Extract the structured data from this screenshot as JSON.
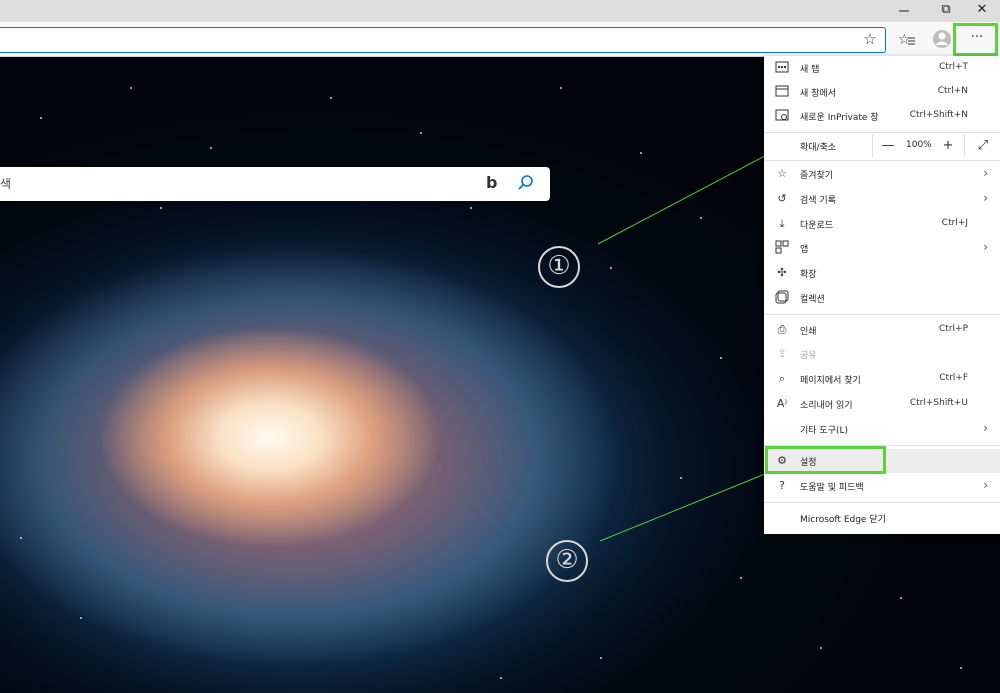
{
  "window": {
    "restore_glyph": "⧉",
    "close_glyph": "✕"
  },
  "toolbar": {
    "favorite_star_glyph": "☆",
    "favorites_glyph": "✩≡",
    "more_label": "···"
  },
  "search": {
    "partial_text": "색"
  },
  "callouts": [
    "①",
    "②"
  ],
  "menu": {
    "items": [
      {
        "icon": "new-tab-icon",
        "label": "새 탭",
        "shortcut": "Ctrl+T"
      },
      {
        "icon": "new-window-icon",
        "label": "새 창에서",
        "shortcut": "Ctrl+N"
      },
      {
        "icon": "inprivate-icon",
        "label": "새로운 InPrivate 창",
        "shortcut": "Ctrl+Shift+N"
      }
    ],
    "zoom": {
      "label": "확대/축소",
      "minus": "—",
      "value": "100%",
      "plus": "+",
      "fullscreen": "⤢"
    },
    "items2": [
      {
        "icon": "favorites-icon",
        "label": "즐겨찾기",
        "shortcut": "",
        "arrow": true
      },
      {
        "icon": "history-icon",
        "label": "검색 기록",
        "shortcut": "",
        "arrow": true
      },
      {
        "icon": "download-icon",
        "label": "다운로드",
        "shortcut": "Ctrl+J",
        "arrow": false
      },
      {
        "icon": "apps-icon",
        "label": "앱",
        "shortcut": "",
        "arrow": true
      },
      {
        "icon": "extensions-icon",
        "label": "확장",
        "shortcut": "",
        "arrow": false
      },
      {
        "icon": "collections-icon",
        "label": "컬렉션",
        "shortcut": "",
        "arrow": false
      }
    ],
    "items3": [
      {
        "icon": "print-icon",
        "label": "인쇄",
        "shortcut": "Ctrl+P",
        "arrow": false,
        "disabled": false
      },
      {
        "icon": "share-icon",
        "label": "공유",
        "shortcut": "",
        "arrow": false,
        "disabled": true
      },
      {
        "icon": "find-icon",
        "label": "페이지에서 찾기",
        "shortcut": "Ctrl+F",
        "arrow": false,
        "disabled": false
      },
      {
        "icon": "read-aloud-icon",
        "label": "소리내어 읽기",
        "shortcut": "Ctrl+Shift+U",
        "arrow": false,
        "disabled": false
      },
      {
        "icon": "",
        "label": "기타 도구(L)",
        "shortcut": "",
        "arrow": true,
        "disabled": false
      }
    ],
    "items4": [
      {
        "icon": "gear-icon",
        "label": "설정",
        "shortcut": "",
        "arrow": false
      },
      {
        "icon": "help-icon",
        "label": "도움말 및 피드백",
        "shortcut": "",
        "arrow": true
      }
    ],
    "close_label": "Microsoft Edge 닫기"
  }
}
